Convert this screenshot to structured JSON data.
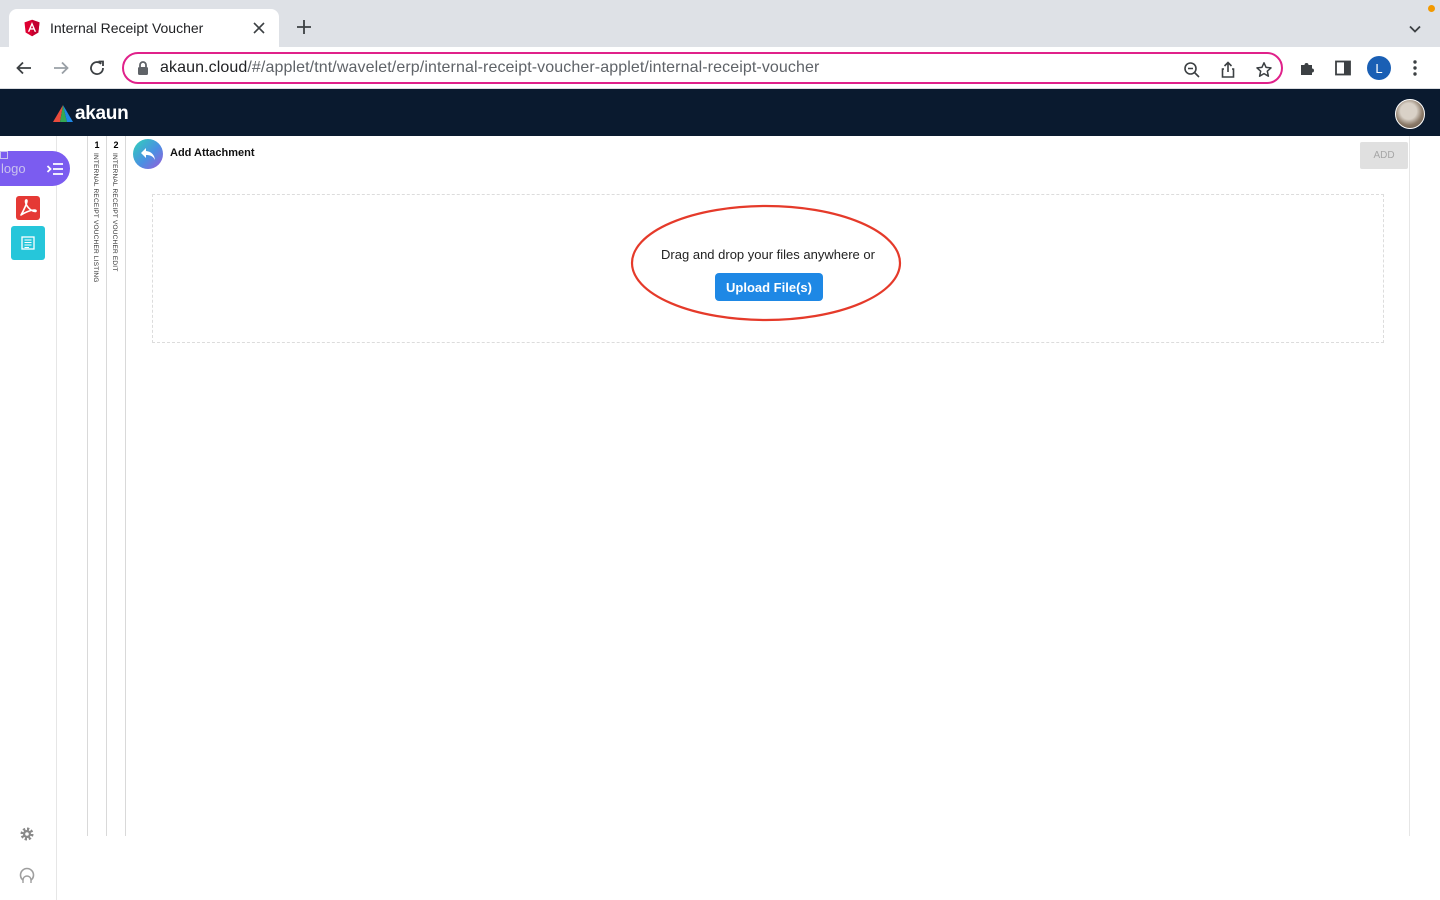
{
  "browser": {
    "tab_title": "Internal Receipt Voucher",
    "url_host": "akaun.cloud",
    "url_path": "/#/applet/tnt/wavelet/erp/internal-receipt-voucher-applet/internal-receipt-voucher",
    "profile_initial": "L",
    "accent_color": "#e0218a"
  },
  "app": {
    "brand": "akaun",
    "header_color": "#0a1a2f"
  },
  "sidebar": {
    "logo_alt": "logo",
    "apps": [
      {
        "icon": "acrobat-icon",
        "color": "#e53935"
      },
      {
        "icon": "list-icon",
        "color": "#26c6da"
      }
    ],
    "bottom": [
      {
        "icon": "gear-icon"
      },
      {
        "icon": "user-icon"
      }
    ]
  },
  "breadcrumbs": [
    {
      "number": "1",
      "label": "INTERNAL RECEIPT VOUCHER LISTING"
    },
    {
      "number": "2",
      "label": "INTERNAL RECEIPT VOUCHER EDIT"
    }
  ],
  "page": {
    "title": "Add Attachment",
    "add_label": "ADD",
    "drop_text": "Drag and drop your files anywhere or",
    "upload_label": "Upload File(s)"
  }
}
